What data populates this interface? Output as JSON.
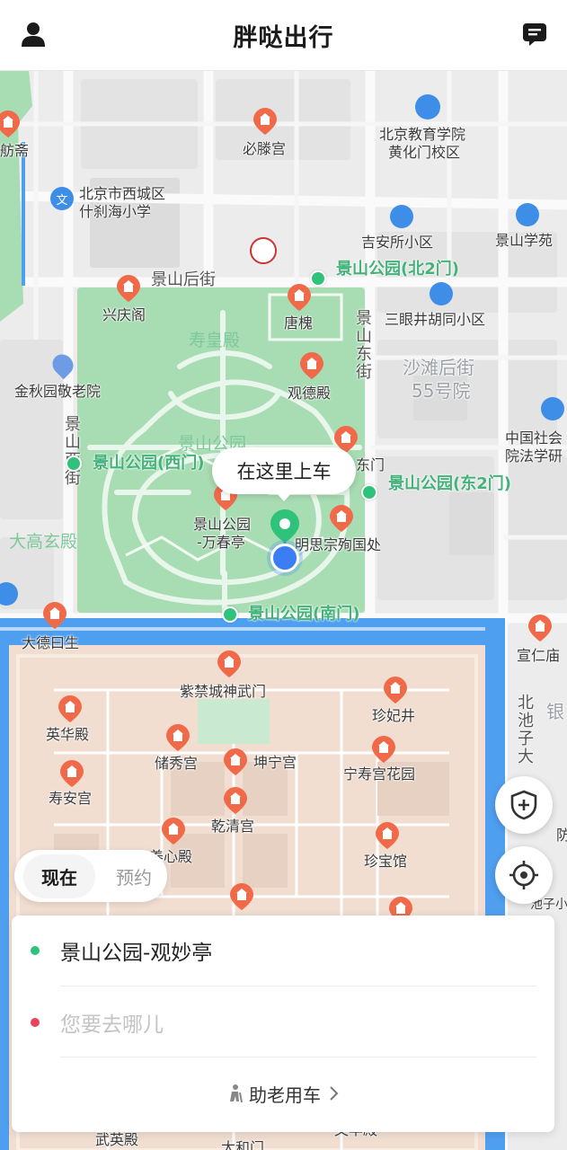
{
  "header": {
    "title": "胖哒出行",
    "user_icon": "user-icon",
    "message_icon": "message-icon"
  },
  "map": {
    "callout": "在这里上车",
    "stops": [
      {
        "id": "north2",
        "label": "景山公园(北2门)"
      },
      {
        "id": "west",
        "label": "景山公园(西门)"
      },
      {
        "id": "east2",
        "label": "景山公园(东2门)"
      },
      {
        "id": "south",
        "label": "景山公园(南门)"
      }
    ],
    "labels": {
      "bishenggong": "必滕宫",
      "jiaoyu1": "北京教育学院",
      "jiaoyu2": "黄化门校区",
      "shichahai1": "北京市西城区",
      "shichahai2": "什刹海小学",
      "jianguo": "吉安所小区",
      "jingshanxueyuan": "景山学苑",
      "houjie": "景山后街",
      "xingqingge": "兴庆阁",
      "tanghuai": "唐槐",
      "sanyan": "三眼井胡同小区",
      "shouhuangdian": "寿皇殿",
      "jingshandongjie": "景山东街",
      "shatan1": "沙滩后街",
      "shatan2": "55号院",
      "jinqiuyuan": "金秋园敬老院",
      "guandedian": "观德殿",
      "jingshanxijie": "景山西街",
      "shehui1": "中国社会",
      "shehui2": "院法学研",
      "park_faint": "景山公园",
      "east_door": "东门",
      "dagaoxuan": "大高玄殿",
      "wanchunting1": "景山公园",
      "wanchunting2": "-万春亭",
      "mingsi": "明思宗殉国处",
      "dadeyuesheng": "大德曰生",
      "shenwumen": "紫禁城神武门",
      "xuanrenmiao": "宣仁庙",
      "zhenfeijing": "珍妃井",
      "yinghuadian": "英华殿",
      "chuxiugong": "储秀宫",
      "kunninggong": "坤宁宫",
      "ningshou": "宁寿宫花园",
      "beichizi": "北池子大",
      "shouangong": "寿安宫",
      "qianqinggong": "乾清宫",
      "yangxindian": "养心殿",
      "zhenbaoguan": "珍宝馆",
      "wuyingdian": "武英殿",
      "taihemen": "太和门",
      "wenhuadian": "文华殿",
      "fangzhai": "舫斋",
      "yin": "银",
      "fang": "防",
      "xiao": "池子小学",
      "wen": "文"
    }
  },
  "mode": {
    "now": "现在",
    "later": "预约"
  },
  "trip": {
    "pickup": "景山公园-观妙亭",
    "destination_placeholder": "您要去哪儿",
    "elder_label": "助老用车"
  },
  "colors": {
    "accent_green": "#2fc27a",
    "dest_red": "#e8445a",
    "water": "#4f9ff0",
    "park": "#a8dcb2",
    "palace": "#f1ded1"
  }
}
